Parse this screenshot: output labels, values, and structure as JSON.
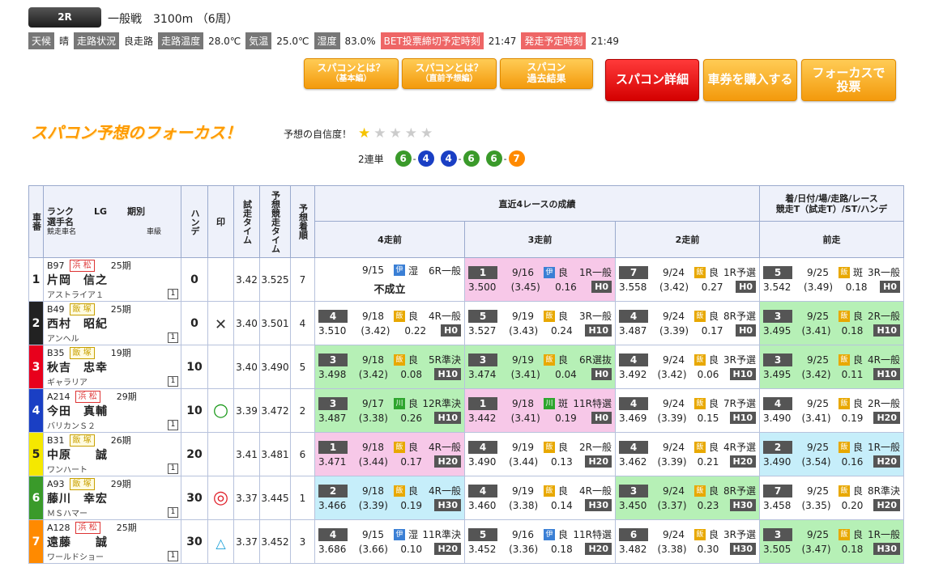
{
  "race": {
    "badge": "2R",
    "title": "一般戦　3100m （6周）"
  },
  "info": {
    "weather_label": "天候",
    "weather": "晴",
    "track_label": "走路状況",
    "track": "良走路",
    "track_temp_label": "走路温度",
    "track_temp": "28.0℃",
    "air_temp_label": "気温",
    "air_temp": "25.0℃",
    "humidity_label": "湿度",
    "humidity": "83.0%",
    "bet_close_label": "BET投票締切予定時刻",
    "bet_close": "21:47",
    "start_label": "発走予定時刻",
    "start": "21:49"
  },
  "buttons": {
    "about_basic": [
      "スパコンとは？",
      "（基本編）"
    ],
    "about_pre": [
      "スパコンとは？",
      "（直前予想編）"
    ],
    "past": [
      "スパコン",
      "過去結果"
    ],
    "detail": "スパコン詳細",
    "buy": "車券を購入する",
    "focus_vote": [
      "フォーカスで",
      "投票"
    ]
  },
  "focus": {
    "title": "スパコン予想のフォーカス！",
    "confidence_label": "予想の自信度！",
    "stars_on": 1,
    "stars_total": 5,
    "bet_type": "2連単",
    "combos": [
      [
        "6",
        "4"
      ],
      [
        "4",
        "6"
      ],
      [
        "6",
        "7"
      ]
    ]
  },
  "colors": {
    "1": "#ffffff",
    "2": "#222222",
    "3": "#e8001c",
    "4": "#1a3fc4",
    "5": "#f5e800",
    "6": "#3a9a2a",
    "7": "#ff8a00",
    "pink": "#f7c8e8",
    "green": "#b6f0b6",
    "blue": "#c6eefa"
  },
  "headers": {
    "car": "車番",
    "rank": "ランク",
    "lg": "LG",
    "term": "期別",
    "player": "選手名",
    "bike": "競走車名",
    "class": "車級",
    "handicap": "ハンデ",
    "mark": "印",
    "trial": "試走タイム",
    "pred": "予想競走タイム",
    "pred_rank": "予想着順",
    "recent": "直近4レースの成績",
    "recent_note1": "着/日付/場/走路/レース",
    "recent_note2": "競走T（試走T）/ST/ハンデ",
    "r4": "4走前",
    "r3": "3走前",
    "r2": "2走前",
    "r1": "前走"
  },
  "rows": [
    {
      "no": "1",
      "rank": "B97",
      "lg": "浜 松",
      "term": "25期",
      "name": "片岡　信之",
      "bike": "アストライア１",
      "cls": "1",
      "hande": "0",
      "mark": "",
      "trial": "3.42",
      "pred": "3.525",
      "prank": "7",
      "races": [
        {
          "fail": true,
          "date": "9/15",
          "venue": "伊",
          "surf": "湿",
          "race": "6R一般",
          "result": "不成立",
          "bg": ""
        },
        {
          "pos": "1",
          "date": "9/16",
          "venue": "伊",
          "surf": "良",
          "race": "1R一般",
          "t": "3.500",
          "tr": "(3.45)",
          "st": "0.16",
          "h": "H0",
          "bg": "pink"
        },
        {
          "pos": "7",
          "date": "9/24",
          "venue": "飯",
          "surf": "良",
          "race": "1R予選",
          "t": "3.558",
          "tr": "(3.42)",
          "st": "0.27",
          "h": "H0",
          "bg": ""
        },
        {
          "pos": "5",
          "date": "9/25",
          "venue": "飯",
          "surf": "斑",
          "race": "3R一般",
          "t": "3.542",
          "tr": "(3.49)",
          "st": "0.18",
          "h": "H0",
          "bg": ""
        }
      ]
    },
    {
      "no": "2",
      "rank": "B49",
      "lg": "飯 塚",
      "term": "25期",
      "name": "西村　昭紀",
      "bike": "アンヘル",
      "cls": "1",
      "hande": "0",
      "mark": "✕",
      "trial": "3.40",
      "pred": "3.501",
      "prank": "4",
      "races": [
        {
          "pos": "4",
          "date": "9/18",
          "venue": "飯",
          "surf": "良",
          "race": "4R一般",
          "t": "3.510",
          "tr": "(3.42)",
          "st": "0.22",
          "h": "H0",
          "bg": ""
        },
        {
          "pos": "5",
          "date": "9/19",
          "venue": "飯",
          "surf": "良",
          "race": "3R一般",
          "t": "3.527",
          "tr": "(3.43)",
          "st": "0.24",
          "h": "H10",
          "bg": ""
        },
        {
          "pos": "4",
          "date": "9/24",
          "venue": "飯",
          "surf": "良",
          "race": "8R予選",
          "t": "3.487",
          "tr": "(3.39)",
          "st": "0.17",
          "h": "H0",
          "bg": ""
        },
        {
          "pos": "3",
          "date": "9/25",
          "venue": "飯",
          "surf": "良",
          "race": "2R一般",
          "t": "3.495",
          "tr": "(3.41)",
          "st": "0.18",
          "h": "H10",
          "bg": "green"
        }
      ]
    },
    {
      "no": "3",
      "rank": "B35",
      "lg": "飯 塚",
      "term": "19期",
      "name": "秋吉　忠幸",
      "bike": "ギャラリア",
      "cls": "1",
      "hande": "10",
      "mark": "",
      "trial": "3.40",
      "pred": "3.490",
      "prank": "5",
      "races": [
        {
          "pos": "3",
          "date": "9/18",
          "venue": "飯",
          "surf": "良",
          "race": "5R準決",
          "t": "3.498",
          "tr": "(3.42)",
          "st": "0.08",
          "h": "H10",
          "bg": "green"
        },
        {
          "pos": "3",
          "date": "9/19",
          "venue": "飯",
          "surf": "良",
          "race": "6R選抜",
          "t": "3.474",
          "tr": "(3.41)",
          "st": "0.04",
          "h": "H0",
          "bg": "green"
        },
        {
          "pos": "4",
          "date": "9/24",
          "venue": "飯",
          "surf": "良",
          "race": "3R予選",
          "t": "3.492",
          "tr": "(3.42)",
          "st": "0.06",
          "h": "H10",
          "bg": ""
        },
        {
          "pos": "3",
          "date": "9/25",
          "venue": "飯",
          "surf": "良",
          "race": "4R一般",
          "t": "3.495",
          "tr": "(3.42)",
          "st": "0.11",
          "h": "H10",
          "bg": "green"
        }
      ]
    },
    {
      "no": "4",
      "rank": "A214",
      "lg": "浜 松",
      "term": "29期",
      "name": "今田　真輔",
      "bike": "バリカンＳ２",
      "cls": "1",
      "hande": "10",
      "mark": "○",
      "trial": "3.39",
      "pred": "3.472",
      "prank": "2",
      "races": [
        {
          "pos": "3",
          "date": "9/17",
          "venue": "川",
          "surf": "良",
          "race": "12R準決",
          "t": "3.487",
          "tr": "(3.38)",
          "st": "0.26",
          "h": "H10",
          "bg": "green"
        },
        {
          "pos": "1",
          "date": "9/18",
          "venue": "川",
          "surf": "斑",
          "race": "11R特選",
          "t": "3.442",
          "tr": "(3.41)",
          "st": "0.19",
          "h": "H0",
          "bg": "pink"
        },
        {
          "pos": "4",
          "date": "9/24",
          "venue": "飯",
          "surf": "良",
          "race": "7R予選",
          "t": "3.469",
          "tr": "(3.39)",
          "st": "0.15",
          "h": "H10",
          "bg": ""
        },
        {
          "pos": "4",
          "date": "9/25",
          "venue": "飯",
          "surf": "良",
          "race": "2R一般",
          "t": "3.490",
          "tr": "(3.41)",
          "st": "0.19",
          "h": "H20",
          "bg": ""
        }
      ]
    },
    {
      "no": "5",
      "rank": "B31",
      "lg": "飯 塚",
      "term": "26期",
      "name": "中原　　誠",
      "bike": "ワンハート",
      "cls": "1",
      "hande": "20",
      "mark": "",
      "trial": "3.41",
      "pred": "3.481",
      "prank": "6",
      "races": [
        {
          "pos": "1",
          "date": "9/18",
          "venue": "飯",
          "surf": "良",
          "race": "4R一般",
          "t": "3.471",
          "tr": "(3.44)",
          "st": "0.17",
          "h": "H20",
          "bg": "pink"
        },
        {
          "pos": "4",
          "date": "9/19",
          "venue": "飯",
          "surf": "良",
          "race": "2R一般",
          "t": "3.490",
          "tr": "(3.44)",
          "st": "0.13",
          "h": "H20",
          "bg": ""
        },
        {
          "pos": "4",
          "date": "9/24",
          "venue": "飯",
          "surf": "良",
          "race": "4R予選",
          "t": "3.462",
          "tr": "(3.39)",
          "st": "0.21",
          "h": "H20",
          "bg": ""
        },
        {
          "pos": "2",
          "date": "9/25",
          "venue": "飯",
          "surf": "良",
          "race": "1R一般",
          "t": "3.490",
          "tr": "(3.54)",
          "st": "0.16",
          "h": "H20",
          "bg": "blue"
        }
      ]
    },
    {
      "no": "6",
      "rank": "A93",
      "lg": "飯 塚",
      "term": "29期",
      "name": "藤川　幸宏",
      "bike": "ＭＳハマー",
      "cls": "1",
      "hande": "30",
      "mark": "◎",
      "trial": "3.37",
      "pred": "3.445",
      "prank": "1",
      "races": [
        {
          "pos": "2",
          "date": "9/18",
          "venue": "飯",
          "surf": "良",
          "race": "4R一般",
          "t": "3.466",
          "tr": "(3.39)",
          "st": "0.19",
          "h": "H30",
          "bg": "blue"
        },
        {
          "pos": "4",
          "date": "9/19",
          "venue": "飯",
          "surf": "良",
          "race": "4R一般",
          "t": "3.460",
          "tr": "(3.38)",
          "st": "0.14",
          "h": "H30",
          "bg": ""
        },
        {
          "pos": "3",
          "date": "9/24",
          "venue": "飯",
          "surf": "良",
          "race": "8R予選",
          "t": "3.450",
          "tr": "(3.37)",
          "st": "0.23",
          "h": "H30",
          "bg": "green"
        },
        {
          "pos": "7",
          "date": "9/25",
          "venue": "飯",
          "surf": "良",
          "race": "8R準決",
          "t": "3.458",
          "tr": "(3.35)",
          "st": "0.20",
          "h": "H20",
          "bg": ""
        }
      ]
    },
    {
      "no": "7",
      "rank": "A128",
      "lg": "浜 松",
      "term": "25期",
      "name": "遠藤　　誠",
      "bike": "ワールドショー",
      "cls": "1",
      "hande": "30",
      "mark": "△",
      "trial": "3.37",
      "pred": "3.452",
      "prank": "3",
      "races": [
        {
          "pos": "4",
          "date": "9/15",
          "venue": "伊",
          "surf": "湿",
          "race": "11R準決",
          "t": "3.686",
          "tr": "(3.66)",
          "st": "0.10",
          "h": "H20",
          "bg": ""
        },
        {
          "pos": "5",
          "date": "9/16",
          "venue": "伊",
          "surf": "良",
          "race": "11R特選",
          "t": "3.452",
          "tr": "(3.36)",
          "st": "0.18",
          "h": "H20",
          "bg": ""
        },
        {
          "pos": "6",
          "date": "9/24",
          "venue": "飯",
          "surf": "良",
          "race": "3R予選",
          "t": "3.482",
          "tr": "(3.38)",
          "st": "0.30",
          "h": "H30",
          "bg": ""
        },
        {
          "pos": "3",
          "date": "9/25",
          "venue": "飯",
          "surf": "良",
          "race": "1R一般",
          "t": "3.505",
          "tr": "(3.47)",
          "st": "0.18",
          "h": "H30",
          "bg": "green"
        }
      ]
    }
  ]
}
